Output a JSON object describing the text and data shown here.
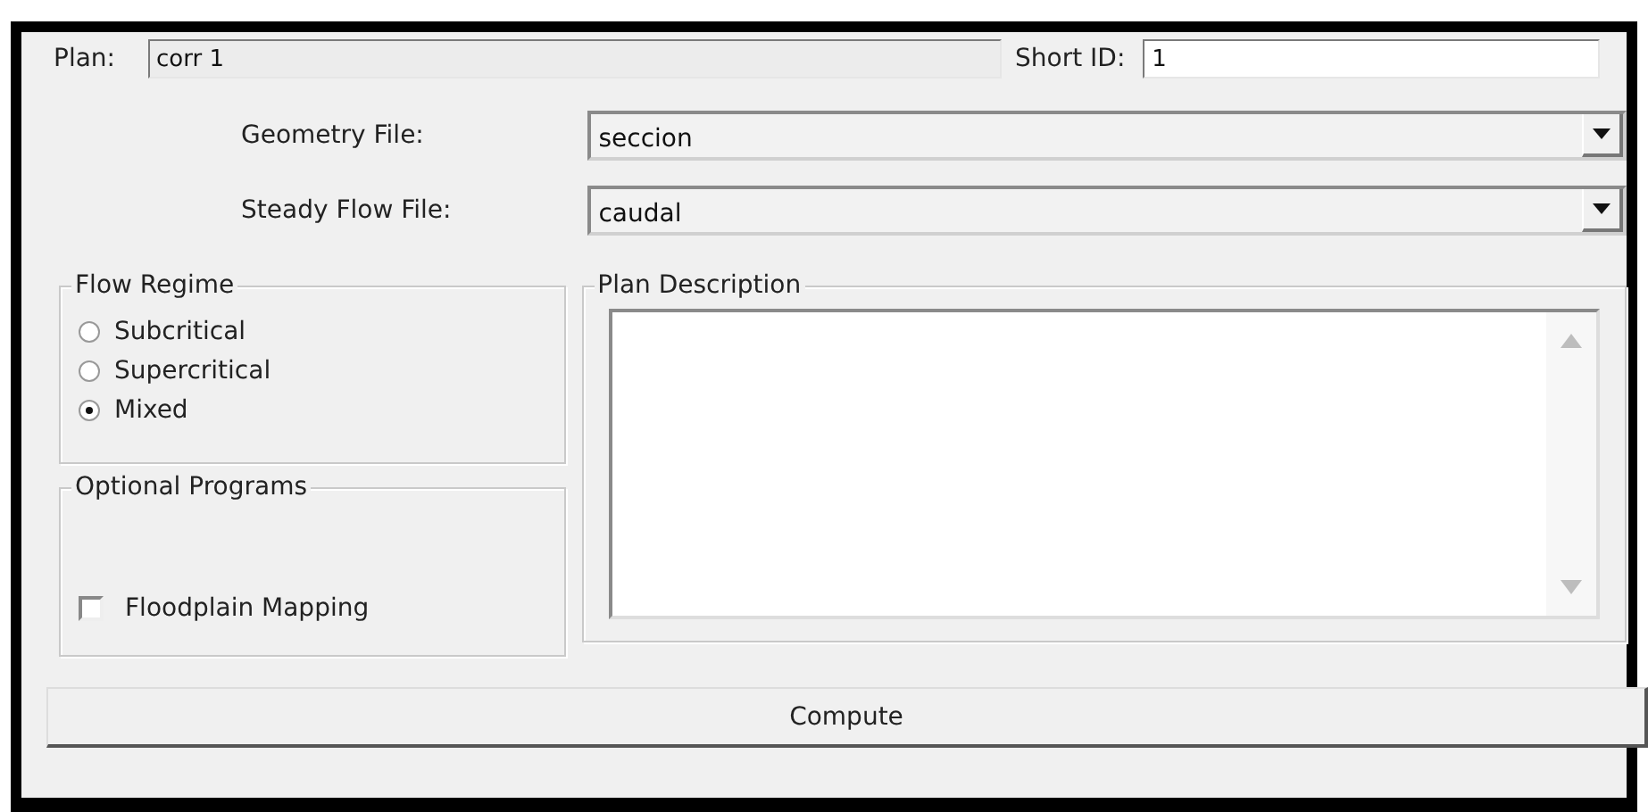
{
  "plan": {
    "label": "Plan:",
    "value": "corr 1"
  },
  "short_id": {
    "label": "Short ID:",
    "value": "1"
  },
  "files": [
    {
      "label": "Geometry File:",
      "value": "seccion"
    },
    {
      "label": "Steady Flow File:",
      "value": "caudal"
    }
  ],
  "flow_regime": {
    "title": "Flow Regime",
    "options": [
      {
        "label": "Subcritical",
        "selected": false
      },
      {
        "label": "Supercritical",
        "selected": false
      },
      {
        "label": "Mixed",
        "selected": true
      }
    ]
  },
  "optional_programs": {
    "title": "Optional Programs",
    "items": [
      {
        "label": "Floodplain Mapping",
        "checked": false
      }
    ]
  },
  "plan_description": {
    "title": "Plan Description"
  },
  "compute_button": "Compute"
}
